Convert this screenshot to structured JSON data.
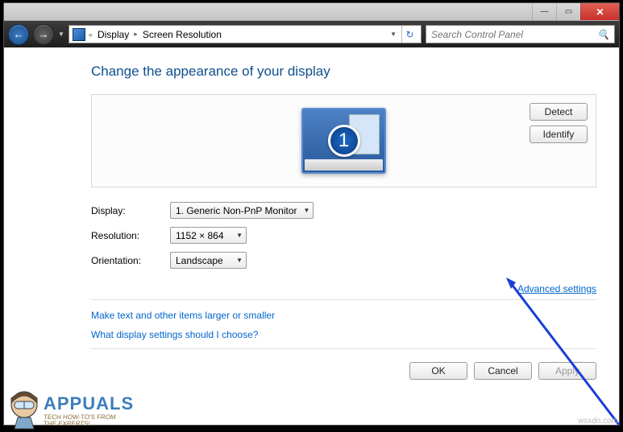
{
  "breadcrumb": {
    "sep_before": "«",
    "part1": "Display",
    "part2": "Screen Resolution"
  },
  "search": {
    "placeholder": "Search Control Panel"
  },
  "heading": "Change the appearance of your display",
  "monitor_number": "1",
  "side_buttons": {
    "detect": "Detect",
    "identify": "Identify"
  },
  "labels": {
    "display": "Display:",
    "resolution": "Resolution:",
    "orientation": "Orientation:"
  },
  "values": {
    "display": "1. Generic Non-PnP Monitor",
    "resolution": "1152 × 864",
    "orientation": "Landscape"
  },
  "advanced_link": "Advanced settings",
  "help": {
    "link1": "Make text and other items larger or smaller",
    "link2": "What display settings should I choose?"
  },
  "footer": {
    "ok": "OK",
    "cancel": "Cancel",
    "apply": "Apply"
  },
  "logo": {
    "brand": "APPUALS",
    "tag1": "TECH HOW-TO'S FROM",
    "tag2": "THE EXPERTS!"
  },
  "watermark": "wsxdn.com"
}
